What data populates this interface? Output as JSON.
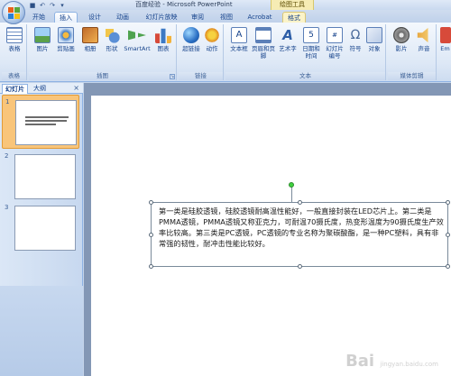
{
  "title_bar": {
    "title": "百度经验 - Microsoft PowerPoint",
    "context_tab": "绘图工具"
  },
  "tabs": [
    {
      "label": "开始"
    },
    {
      "label": "插入",
      "active": true
    },
    {
      "label": "设计"
    },
    {
      "label": "动画"
    },
    {
      "label": "幻灯片放映"
    },
    {
      "label": "审阅"
    },
    {
      "label": "视图"
    },
    {
      "label": "Acrobat"
    },
    {
      "label": "格式"
    }
  ],
  "ribbon": {
    "groups": [
      {
        "label": "表格",
        "buttons": [
          {
            "label": "表格",
            "icon": "table-icon"
          }
        ]
      },
      {
        "label": "插图",
        "buttons": [
          {
            "label": "图片",
            "icon": "picture-icon"
          },
          {
            "label": "剪贴画",
            "icon": "clipart-icon"
          },
          {
            "label": "相册",
            "icon": "album-icon"
          },
          {
            "label": "形状",
            "icon": "shapes-icon"
          },
          {
            "label": "SmartArt",
            "icon": "smartart-icon"
          },
          {
            "label": "图表",
            "icon": "chart-icon"
          }
        ]
      },
      {
        "label": "链接",
        "buttons": [
          {
            "label": "超链接",
            "icon": "hyperlink-icon"
          },
          {
            "label": "动作",
            "icon": "action-icon"
          }
        ]
      },
      {
        "label": "文本",
        "buttons": [
          {
            "label": "文本框",
            "icon": "textbox-icon"
          },
          {
            "label": "页眉和页脚",
            "icon": "header-footer-icon"
          },
          {
            "label": "艺术字",
            "icon": "wordart-icon"
          },
          {
            "label": "日期和时间",
            "icon": "datetime-icon"
          },
          {
            "label": "幻灯片编号",
            "icon": "slide-number-icon"
          },
          {
            "label": "符号",
            "icon": "symbol-icon"
          },
          {
            "label": "对象",
            "icon": "object-icon"
          }
        ]
      },
      {
        "label": "媒体剪辑",
        "buttons": [
          {
            "label": "影片",
            "icon": "movie-icon"
          },
          {
            "label": "声音",
            "icon": "sound-icon"
          }
        ]
      }
    ],
    "partial_button": "Em"
  },
  "pane": {
    "tab_slides": "幻灯片",
    "tab_outline": "大纲",
    "close": "×",
    "slides": [
      {
        "number": "1",
        "selected": true
      },
      {
        "number": "2",
        "selected": false
      },
      {
        "number": "3",
        "selected": false
      }
    ]
  },
  "slide": {
    "text": "第一类是硅胶透镜，硅胶透镜耐高温性能好，一般直接封装在LED芯片上。第二类是PMMA透镜，PMMA透镜又称亚克力，可耐温70摄氏度，热变形温度为90摄氏度生产效率比较高。第三类是PC透镜，PC透镜的专业名称为聚碳酸酯，是一种PC塑料，具有非常强的韧性，耐冲击性能比较好。"
  },
  "watermark": {
    "text": "Bai",
    "sub": "jingyan.baidu.com"
  }
}
